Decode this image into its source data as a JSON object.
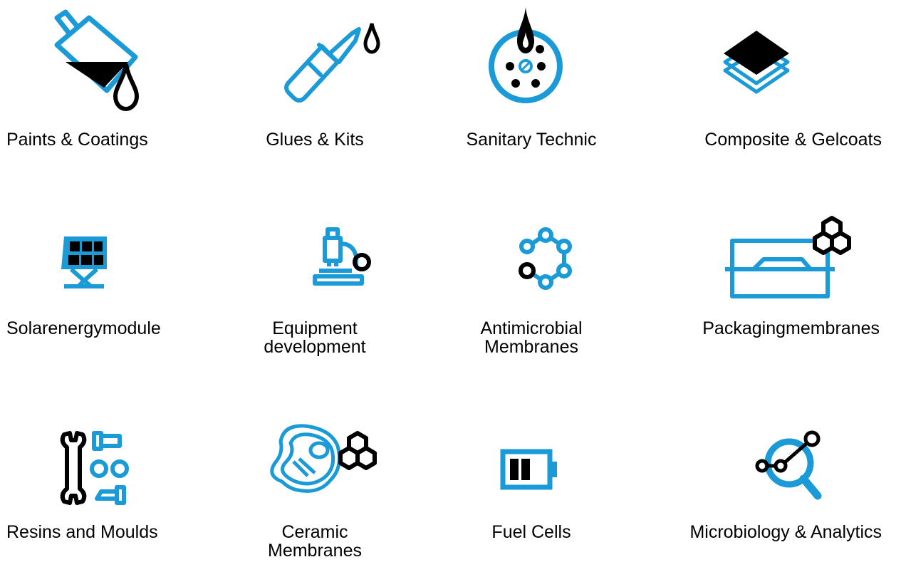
{
  "accent_color": "#1a9ad6",
  "items": [
    {
      "label": "Paints & Coatings",
      "icon": "paint-bucket-icon"
    },
    {
      "label": "Glues & Kits",
      "icon": "glue-tube-icon"
    },
    {
      "label": "Sanitary Technic",
      "icon": "petri-dish-icon"
    },
    {
      "label": "Composite & Gelcoats",
      "icon": "layers-icon"
    },
    {
      "label": "Solarenergymodule",
      "icon": "solar-panel-icon"
    },
    {
      "label": "Equipment\ndevelopment",
      "icon": "microscope-icon"
    },
    {
      "label": "Antimicrobial\nMembranes",
      "icon": "molecule-ring-icon"
    },
    {
      "label": "Packagingmembranes",
      "icon": "packaging-tray-icon"
    },
    {
      "label": "Resins and Moulds",
      "icon": "wrench-bolts-icon"
    },
    {
      "label": "Ceramic\nMembranes",
      "icon": "ceramic-molecule-icon"
    },
    {
      "label": "Fuel Cells",
      "icon": "battery-icon"
    },
    {
      "label": "Microbiology & Analytics",
      "icon": "magnifier-network-icon"
    }
  ]
}
